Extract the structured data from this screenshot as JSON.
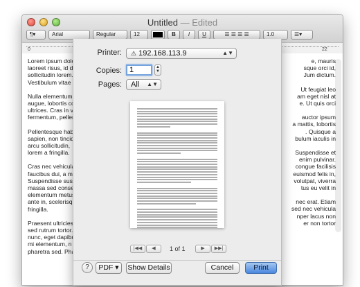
{
  "window": {
    "title": "Untitled",
    "edited": "— Edited"
  },
  "toolbar": {
    "paragraph_style": "¶▾",
    "font_family": "Arial",
    "font_style": "Regular",
    "font_size": "12",
    "bold": "B",
    "italic": "I",
    "underline": "U",
    "spacing": "1.0",
    "list": "☰▾"
  },
  "ruler": {
    "ticks": [
      "0",
      "22"
    ]
  },
  "document": {
    "left_column": [
      "Lorem ipsum dolor sit",
      "laoreet risus, id d",
      "sollicitudin lorem.",
      "Vestibulum vitae b",
      "",
      "Nulla elementum",
      "augue, lobortis co",
      "ultrices. Cras in v",
      "fermentum, pellen",
      "",
      "Pellentesque habi",
      "sapien, non tincid",
      "arcu sollicitudin,",
      "lorem a fringilla.",
      "",
      "Cras nec vehicula",
      "faucibus dui, a m",
      "Suspendisse susc",
      "massa sed conse",
      "elementum metus",
      "ante in, scelerisq",
      "fringilla.",
      "",
      "Praesent ultricies",
      "sed rutrum tortor.",
      "nunc, eget dapibu",
      "mi elementum, n",
      "pharetra sed. Pha"
    ],
    "right_column": [
      "e, mauris",
      "sque orci id,",
      "Jum dictum.",
      "",
      "Ut feugiat leo",
      "am eget nisl at",
      "e. Ut quis orci",
      "",
      "auctor ipsum",
      "a mattis, lobortis",
      ". Quisque a",
      "bulum iaculis in",
      "",
      "Suspendisse et",
      "enim pulvinar.",
      "congue facilisis",
      "euismod felis in,",
      "volutpat, viverra",
      "tus eu velit in",
      "",
      "nec erat. Etiam",
      "sed nec vehicula",
      "nper lacus non",
      "er non tortor"
    ]
  },
  "print": {
    "printer_label": "Printer:",
    "printer_value": "192.168.113.9",
    "copies_label": "Copies:",
    "copies_value": "1",
    "pages_label": "Pages:",
    "pages_value": "All",
    "page_indicator": "1 of 1",
    "pdf_button": "PDF ▾",
    "help": "?",
    "show_details": "Show Details",
    "cancel": "Cancel",
    "print": "Print"
  },
  "icons": {
    "printer": "printer-warning-icon",
    "first_page": "first-page-icon",
    "prev_page": "prev-page-icon",
    "next_page": "next-page-icon",
    "last_page": "last-page-icon"
  },
  "colors": {
    "primary_button": "#4a88df",
    "focus_ring": "#76a4df"
  }
}
